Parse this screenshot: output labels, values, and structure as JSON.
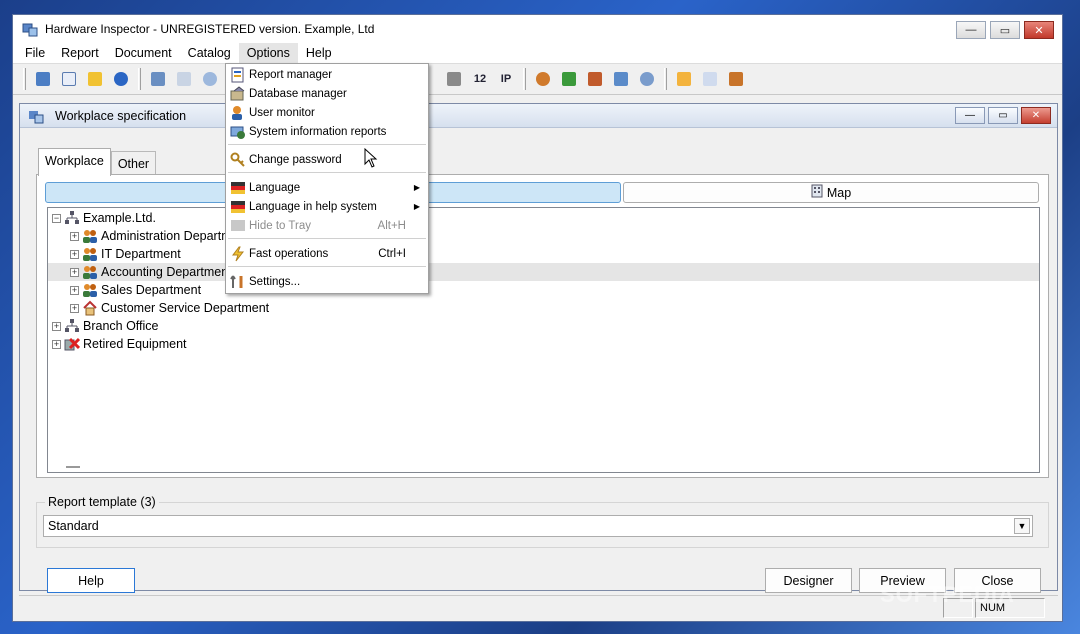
{
  "window": {
    "title": "Hardware Inspector - UNREGISTERED version. Example, Ltd",
    "minimize": "—",
    "maximize": "▭",
    "close": "✕"
  },
  "menubar": {
    "items": [
      "File",
      "Report",
      "Document",
      "Catalog",
      "Options",
      "Help"
    ]
  },
  "toolbar": {
    "label_12": "12",
    "label_ip": "IP"
  },
  "options_menu": {
    "items": [
      {
        "label": "Report manager",
        "icon": "report-manager-icon"
      },
      {
        "label": "Database manager",
        "icon": "database-icon"
      },
      {
        "label": "User monitor",
        "icon": "user-monitor-icon"
      },
      {
        "label": "System information reports",
        "icon": "system-info-icon"
      },
      {
        "label": "Change password",
        "icon": "key-icon"
      },
      {
        "label": "Language",
        "icon": "language-flag-icon",
        "submenu": true
      },
      {
        "label": "Language in help system",
        "icon": "language-flag-icon",
        "submenu": true
      },
      {
        "label": "Hide to Tray",
        "shortcut": "Alt+H",
        "disabled": true
      },
      {
        "label": "Fast operations",
        "shortcut": "Ctrl+I",
        "icon": "lightning-icon"
      },
      {
        "label": "Settings...",
        "icon": "tools-icon"
      }
    ]
  },
  "workplace_window": {
    "title": "Workplace specification",
    "tabs": [
      "Workplace",
      "Other"
    ],
    "view_toggle": {
      "map_label": "Map"
    },
    "tree": [
      {
        "label": "Example.Ltd.",
        "level": 0,
        "icon": "org-chart-icon",
        "expand": "−"
      },
      {
        "label": "Administration Department",
        "level": 1,
        "icon": "users-group-icon",
        "expand": "+"
      },
      {
        "label": "IT Department",
        "level": 1,
        "icon": "users-group-icon",
        "expand": "+"
      },
      {
        "label": "Accounting Department",
        "level": 1,
        "icon": "users-group-icon",
        "expand": "+",
        "selected": true
      },
      {
        "label": "Sales Department",
        "level": 1,
        "icon": "users-group-icon",
        "expand": "+"
      },
      {
        "label": "Customer Service Department",
        "level": 1,
        "icon": "house-icon",
        "expand": "+"
      },
      {
        "label": "Branch Office",
        "level": 0,
        "icon": "org-chart-icon",
        "expand": "+"
      },
      {
        "label": "Retired Equipment",
        "level": 0,
        "icon": "retired-red-x-icon",
        "expand": "+"
      }
    ],
    "report_template": {
      "label": "Report template (3)",
      "value": "Standard"
    },
    "buttons": {
      "help": "Help",
      "designer": "Designer",
      "preview": "Preview",
      "close": "Close"
    }
  },
  "statusbar": {
    "num": "NUM"
  },
  "watermark": "SOFTPEDIA"
}
